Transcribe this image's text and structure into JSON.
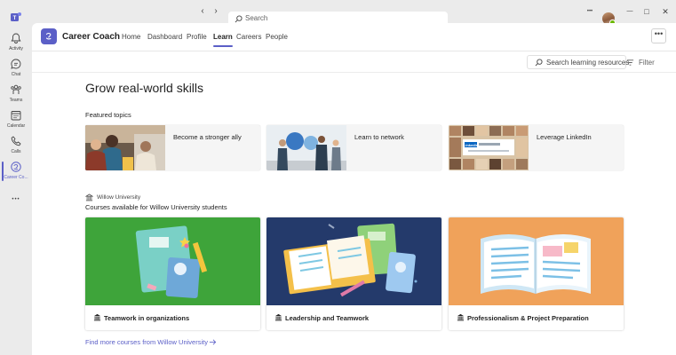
{
  "rail": {
    "items": [
      {
        "label": "Activity",
        "icon": "bell-icon"
      },
      {
        "label": "Chat",
        "icon": "chat-icon"
      },
      {
        "label": "Teams",
        "icon": "teams-icon"
      },
      {
        "label": "Calendar",
        "icon": "calendar-icon"
      },
      {
        "label": "Calls",
        "icon": "phone-icon"
      },
      {
        "label": "Career Co...",
        "icon": "career-coach-icon"
      }
    ],
    "more": "•••"
  },
  "titlebar": {
    "back": "‹",
    "forward": "›",
    "search_placeholder": "Search",
    "more": "•••",
    "minimize": "—",
    "maximize": "□",
    "close": "✕"
  },
  "app": {
    "name": "Career Coach",
    "tabs": [
      "Home",
      "Dashboard",
      "Profile",
      "Learn",
      "Careers",
      "People"
    ],
    "active_tab": "Learn",
    "more": "•••"
  },
  "toolbar": {
    "search_label": "Search learning resources",
    "filter_label": "Filter"
  },
  "main": {
    "title": "Grow real-world skills",
    "featured_heading": "Featured topics",
    "featured": [
      {
        "label": "Become a stronger ally"
      },
      {
        "label": "Learn to network"
      },
      {
        "label": "Leverage LinkedIn",
        "image_text": "LinkedIn"
      }
    ],
    "university_name": "Willow University",
    "courses_heading": "Courses available for Willow University students",
    "courses": [
      {
        "label": "Teamwork in organizations",
        "bg": "#3ea43a"
      },
      {
        "label": "Leadership and Teamwork",
        "bg": "#243a6b"
      },
      {
        "label": "Professionalism & Project Preparation",
        "bg": "#f0a25a"
      }
    ],
    "more_link": "Find more courses from Willow University"
  },
  "colors": {
    "accent": "#5b5fc7",
    "rail_bg": "#ebebeb"
  }
}
